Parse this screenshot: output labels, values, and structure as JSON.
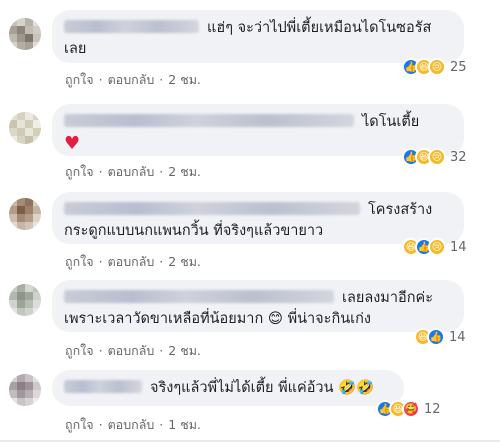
{
  "comments": [
    {
      "text_line1": "แฮ่ๆ จะว่าไปพี่เตี้ยเหมือนไดโนซอรัส",
      "text_line2": "เลย",
      "like": "ถูกใจ",
      "reply": "ตอบกลับ",
      "time": "2 ชม.",
      "count": "25",
      "reactions": [
        "like-icon",
        "haha-icon",
        "sad-icon"
      ]
    },
    {
      "text_line1": "ไดโนเตี้ย",
      "emoji": "♥",
      "like": "ถูกใจ",
      "reply": "ตอบกลับ",
      "time": "2 ชม.",
      "count": "32",
      "reactions": [
        "like-icon",
        "haha-icon",
        "sad-icon"
      ]
    },
    {
      "text_line1": "โครงสร้าง",
      "text_line2": "กระดูกแบบนกแพนกวิ้น ที่จริงๆแล้วขายาว",
      "like": "ถูกใจ",
      "reply": "ตอบกลับ",
      "time": "2 ชม.",
      "count": "14",
      "reactions": [
        "haha-icon",
        "like-icon",
        "sad-icon"
      ]
    },
    {
      "text_line1": "เลยลงมาอีกค่ะ",
      "text_line2": "เพราะเวลาวัดขาเหลือที่น้อยมาก 😊 พี่น่าจะกินเก่ง",
      "like": "ถูกใจ",
      "reply": "ตอบกลับ",
      "time": "2 ชม.",
      "count": "14",
      "reactions": [
        "haha-icon",
        "like-icon"
      ]
    },
    {
      "text_line1": "จริงๆแล้วพี่ไม่ได้เตี้ย พี่แค่อ้วน 🤣🤣",
      "like": "ถูกใจ",
      "reply": "ตอบกลับ",
      "time": "1 ชม.",
      "count": "12",
      "reactions": [
        "like-icon",
        "haha-icon",
        "love-icon"
      ]
    }
  ],
  "colors": {
    "like": "#1877f2",
    "haha": "#f7b928",
    "love": "#f33e58",
    "bubble": "#f0f2f5",
    "meta": "#65676b"
  }
}
